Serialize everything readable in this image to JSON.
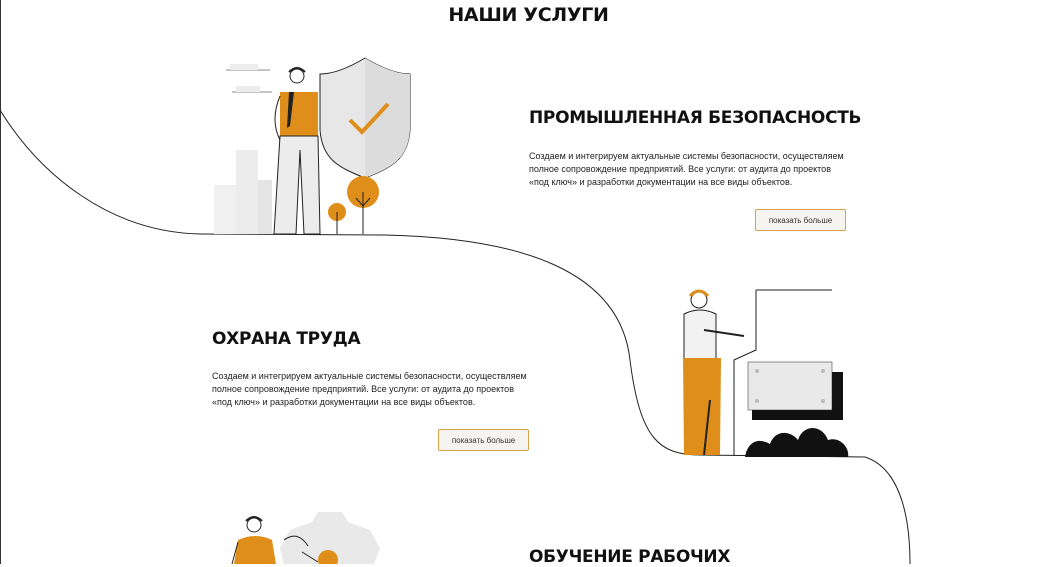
{
  "page": {
    "heading": "НАШИ УСЛУГИ"
  },
  "services": [
    {
      "title": "ПРОМЫШЛЕННАЯ БЕЗОПАСНОСТЬ",
      "lines": [
        "Создаем и интегрируем актуальные системы безопасности, осуществляем",
        "полное сопровождение предприятий. Все услуги: от аудита до проектов",
        "«под ключ» и разработки документации на все виды объектов."
      ],
      "button": "показать больше",
      "illustration": "security-shield-illustration"
    },
    {
      "title": "ОХРАНА ТРУДА",
      "lines": [
        "Создаем и интегрируем актуальные системы безопасности, осуществляем",
        "полное сопровождение предприятий. Все услуги: от аудита до проектов",
        "«под ключ» и разработки документации на все виды объектов."
      ],
      "button": "показать больше",
      "illustration": "worker-presentation-illustration"
    },
    {
      "title": "ОБУЧЕНИЕ РАБОЧИХ",
      "illustration": "workers-training-illustration"
    }
  ],
  "colors": {
    "accent": "#df8f19",
    "button_border": "#d9a347",
    "line": "#222222",
    "grey": "#ececec"
  }
}
